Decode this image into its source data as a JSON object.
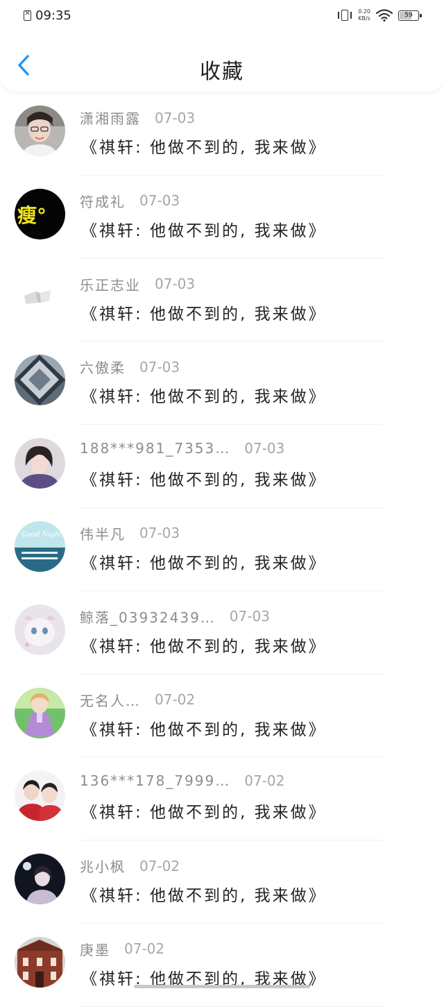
{
  "status_bar": {
    "time": "09:35",
    "speed_value": "0.20",
    "speed_unit": "KB/s",
    "battery": "59",
    "battery_level": 0.59
  },
  "header": {
    "title": "收藏"
  },
  "items": [
    {
      "name": "潇湘雨露",
      "date": "07-03",
      "title": "《祺轩: 他做不到的, 我来做》",
      "avatar": "avatar-man-glasses"
    },
    {
      "name": "符成礼",
      "date": "07-03",
      "title": "《祺轩: 他做不到的, 我来做》",
      "avatar": "avatar-black-yellow-text",
      "avatar_text": "瘦°"
    },
    {
      "name": "乐正志业",
      "date": "07-03",
      "title": "《祺轩: 他做不到的, 我来做》",
      "avatar": "avatar-white-sketch"
    },
    {
      "name": "六傲柔",
      "date": "07-03",
      "title": "《祺轩: 他做不到的, 我来做》",
      "avatar": "avatar-sky-collage"
    },
    {
      "name": "188***981_7353…",
      "date": "07-03",
      "title": "《祺轩: 他做不到的, 我来做》",
      "avatar": "avatar-girl-purple"
    },
    {
      "name": "伟半凡",
      "date": "07-03",
      "title": "《祺轩: 他做不到的, 我来做》",
      "avatar": "avatar-good-night",
      "avatar_text": "Good Night"
    },
    {
      "name": "鲸落_03932439…",
      "date": "07-03",
      "title": "《祺轩: 他做不到的, 我来做》",
      "avatar": "avatar-cute-pet"
    },
    {
      "name": "无名人…",
      "date": "07-02",
      "title": "《祺轩: 他做不到的, 我来做》",
      "avatar": "avatar-cartoon-girl"
    },
    {
      "name": "136***178_7999…",
      "date": "07-02",
      "title": "《祺轩: 他做不到的, 我来做》",
      "avatar": "avatar-two-boys-red"
    },
    {
      "name": "兆小枫",
      "date": "07-02",
      "title": "《祺轩: 他做不到的, 我来做》",
      "avatar": "avatar-girl-dark"
    },
    {
      "name": "庚墨",
      "date": "07-02",
      "title": "《祺轩: 他做不到的, 我来做》",
      "avatar": "avatar-building"
    }
  ],
  "colors": {
    "accent": "#2196f3",
    "name_gray": "#8d8d8d",
    "date_gray": "#a6a6a6",
    "text_dark": "#222222"
  }
}
